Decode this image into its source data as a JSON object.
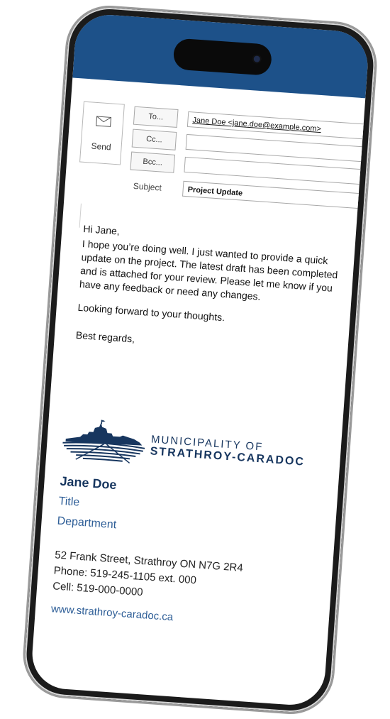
{
  "compose": {
    "send_label": "Send",
    "to_button": "To...",
    "cc_button": "Cc...",
    "bcc_button": "Bcc...",
    "subject_label": "Subject",
    "to_value": "Jane Doe <jane.doe@example.com>",
    "cc_value": "",
    "bcc_value": "",
    "subject_value": "Project Update"
  },
  "body": {
    "greeting": "Hi Jane,",
    "paragraph": "I hope you’re doing well. I just wanted to provide a quick update on the project. The latest draft has been completed and is attached for your review. Please let me know if you have any feedback or need any changes.",
    "closing_line": "Looking forward to your thoughts.",
    "signoff": "Best regards,"
  },
  "signature": {
    "logo_line1": "MUNICIPALITY OF",
    "logo_line2": "STRATHROY-CARADOC",
    "name": "Jane Doe",
    "title": "Title",
    "department": "Department",
    "address": "52 Frank Street, Strathroy ON N7G 2R4",
    "phone": "Phone: 519-245-1105 ext. 000",
    "cell": "Cell: 519-000-0000",
    "website": "www.strathroy-caradoc.ca"
  },
  "colors": {
    "header_bar": "#1d5189",
    "brand_navy": "#17365f",
    "link_blue": "#2e5e97"
  }
}
